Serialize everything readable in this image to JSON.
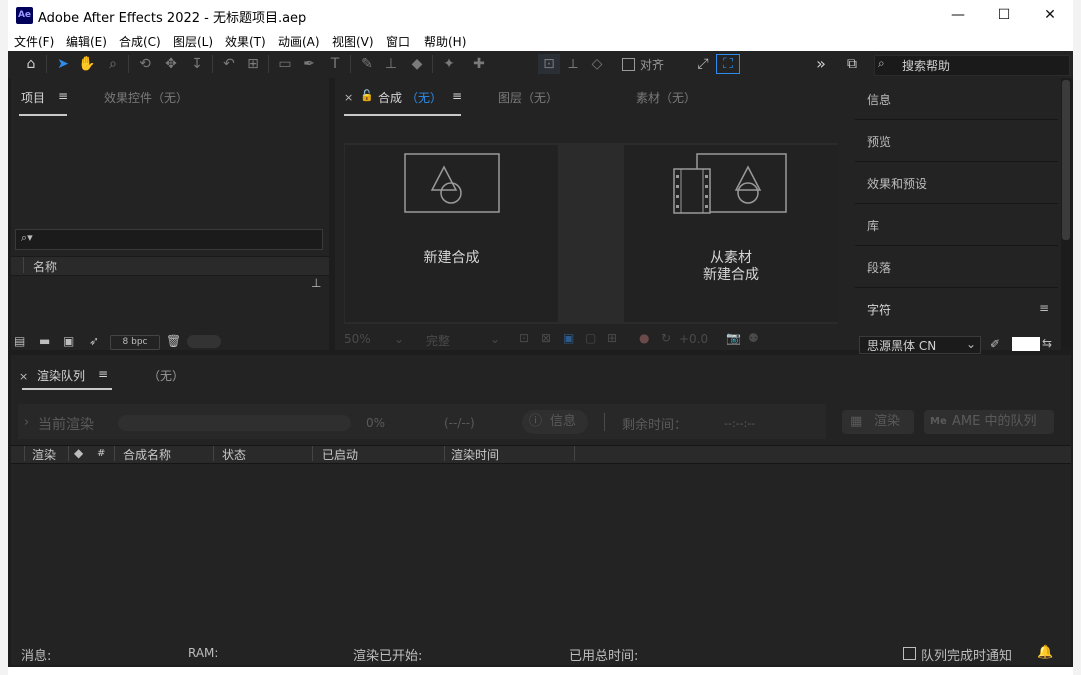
{
  "window": {
    "title": "Adobe After Effects 2022 - 无标题项目.aep",
    "app_icon_text": "Ae",
    "minimize": "—",
    "maximize": "☐",
    "close": "✕"
  },
  "menu": [
    "文件(F)",
    "编辑(E)",
    "合成(C)",
    "图层(L)",
    "效果(T)",
    "动画(A)",
    "视图(V)",
    "窗口",
    "帮助(H)"
  ],
  "toolbar": {
    "snap_label": "对齐",
    "expand_glyph": "»",
    "search_placeholder": "搜索帮助"
  },
  "project_panel": {
    "tab_project": "项目",
    "tab_effect_controls": "效果控件（无）",
    "search_glyph": "⌕▾",
    "column_name": "名称",
    "bpc_label": "8 bpc"
  },
  "composition_panel": {
    "tab_close": "×",
    "tab_comp_label": "合成",
    "tab_comp_value": "（无）",
    "tab_layer": "图层（无）",
    "tab_footage": "素材（无）",
    "card_new_comp": "新建合成",
    "card_from_footage_line1": "从素材",
    "card_from_footage_line2": "新建合成",
    "zoom_value": "50%",
    "resolution_value": "完整",
    "exposure_value": "+0.0"
  },
  "right_panel": {
    "items": [
      "信息",
      "预览",
      "效果和预设",
      "库",
      "段落",
      "字符"
    ],
    "font_value": "思源黑体 CN"
  },
  "render_queue": {
    "tab_close": "×",
    "tab_label": "渲染队列",
    "tab_none": "（无）",
    "current_render_label": "当前渲染",
    "progress_percent": "0%",
    "progress_value": 0,
    "elapsed": "(--/--)",
    "info_button": "信息",
    "remaining_label": "剩余时间：",
    "remaining_value": "--:--:--",
    "render_button": "渲染",
    "ame_button": "AME 中的队列",
    "columns": [
      "渲染",
      "#",
      "合成名称",
      "状态",
      "已启动",
      "渲染时间"
    ]
  },
  "statusbar": {
    "message_label": "消息:",
    "ram_label": "RAM:",
    "render_started_label": "渲染已开始:",
    "total_time_label": "已用总时间:",
    "notify_label": "队列完成时通知"
  },
  "colors": {
    "panel_bg": "#232323",
    "accent_blue": "#2d8ceb",
    "app_icon_bg": "#00005b"
  }
}
